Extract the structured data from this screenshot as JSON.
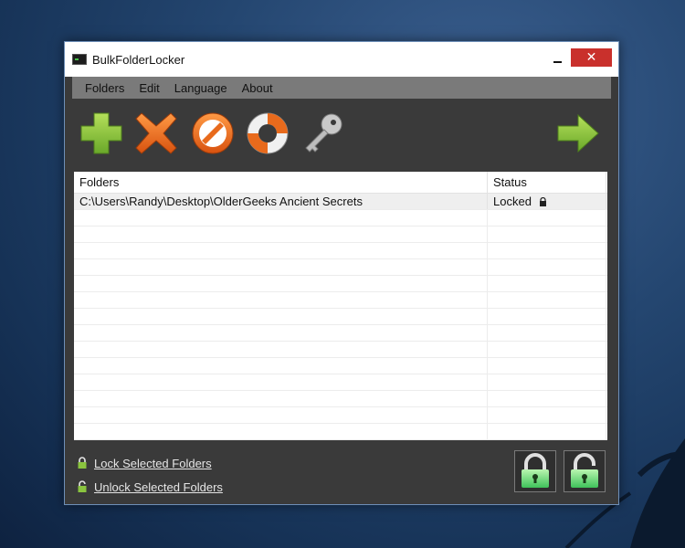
{
  "window": {
    "title": "BulkFolderLocker",
    "close_glyph": "✕"
  },
  "menu": {
    "items": [
      {
        "label": "Folders"
      },
      {
        "label": "Edit"
      },
      {
        "label": "Language"
      },
      {
        "label": "About"
      }
    ]
  },
  "toolbar": {
    "icons": [
      "add-icon",
      "remove-icon",
      "clear-icon",
      "help-icon",
      "key-icon",
      "next-arrow-icon"
    ]
  },
  "table": {
    "headers": {
      "folders": "Folders",
      "status": "Status"
    },
    "rows": [
      {
        "folder": "C:\\Users\\Randy\\Desktop\\OlderGeeks Ancient Secrets",
        "status": "Locked"
      }
    ]
  },
  "actions": {
    "lock_label": "Lock Selected Folders",
    "unlock_label": "Unlock Selected Folders"
  },
  "colors": {
    "accent_green": "#8ac43f",
    "accent_orange": "#e86a1c",
    "close_red": "#c9302c",
    "panel_dark": "#3a3a3a"
  }
}
